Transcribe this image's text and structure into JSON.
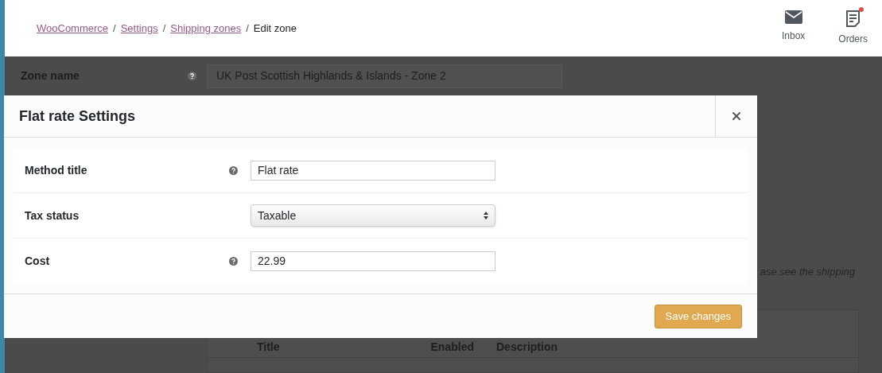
{
  "breadcrumbs": [
    {
      "label": "WooCommerce",
      "link": true
    },
    {
      "label": "Settings",
      "link": true
    },
    {
      "label": "Shipping zones",
      "link": true
    },
    {
      "label": "Edit zone",
      "link": false
    }
  ],
  "separator": "/",
  "header_actions": [
    {
      "kind": "inbox",
      "label": "Inbox",
      "notification": false
    },
    {
      "kind": "orders",
      "label": "Orders",
      "notification": true
    }
  ],
  "zone": {
    "label": "Zone name",
    "value": "UK Post Scottish Highlands & Islands - Zone 2"
  },
  "background_note": "ase see the shipping",
  "table": {
    "columns": [
      "Title",
      "Enabled",
      "Description"
    ]
  },
  "modal": {
    "title": "Flat rate Settings",
    "fields": [
      {
        "kind": "text",
        "label": "Method title",
        "help": true,
        "value": "Flat rate"
      },
      {
        "kind": "select",
        "label": "Tax status",
        "help": false,
        "value": "Taxable"
      },
      {
        "kind": "text",
        "label": "Cost",
        "help": true,
        "value": "22.99"
      }
    ],
    "button": "Save changes"
  }
}
